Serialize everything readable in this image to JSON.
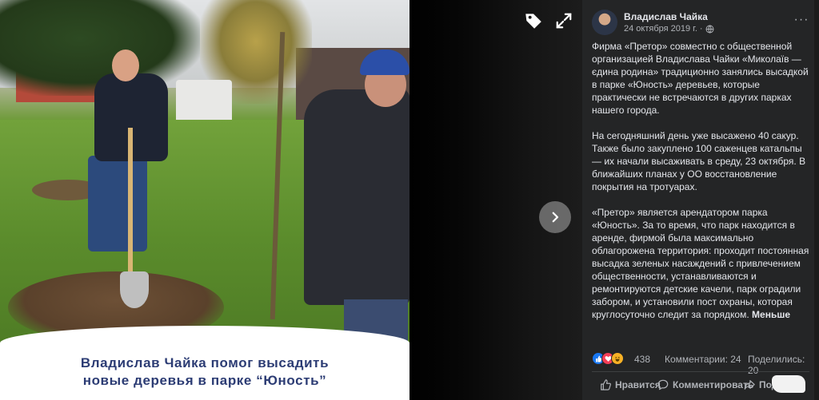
{
  "photo": {
    "caption": "Владислав Чайка помог высадить новые деревья в парке “Юность”"
  },
  "viewer": {
    "tag_icon": "tag-icon",
    "expand_icon": "expand-icon",
    "next_icon": "chevron-right-icon"
  },
  "post": {
    "author": "Владислав Чайка",
    "date": "24 октября 2019 г.",
    "separator": "·",
    "privacy_icon": "globe-icon",
    "more_label": "···",
    "paragraphs": [
      "Фирма «Претор» совместно с общественной организацией Владислава Чайки «Миколаїв — єдина родина» традиционно занялись высадкой в парке «Юность» деревьев, которые практически не встречаются в других парках нашего города.",
      "На сегодняшний день уже высажено 40 сакур. Также было закуплено 100 саженцев катальпы — их начали высаживать в среду, 23 октября. В ближайших планах у ОО восстановление покрытия на тротуарах.",
      "«Претор» является арендатором парка «Юность». За то время, что парк находится в аренде, фирмой была максимально облагорожена территория: проходит постоянная высадка зеленых насаждений с привлечением общественности, устанавливаются и ремонтируются детские качели, парк оградили забором, и установили пост охраны, которая круглосуточно следит за порядком."
    ],
    "less_label": "Меньше",
    "reactions": {
      "count": "438",
      "comments": "Комментарии: 24",
      "shares": "Поделились: 20"
    },
    "actions": {
      "like": "Нравится",
      "comment": "Комментировать",
      "share": "Подел"
    }
  },
  "colors": {
    "panel_bg": "#242526",
    "text_primary": "#e4e6eb",
    "text_secondary": "#b0b3b8",
    "like_blue": "#1877f2",
    "love_red": "#f33e58",
    "haha_yellow": "#f7b125",
    "caption_blue": "#2c3c74"
  }
}
